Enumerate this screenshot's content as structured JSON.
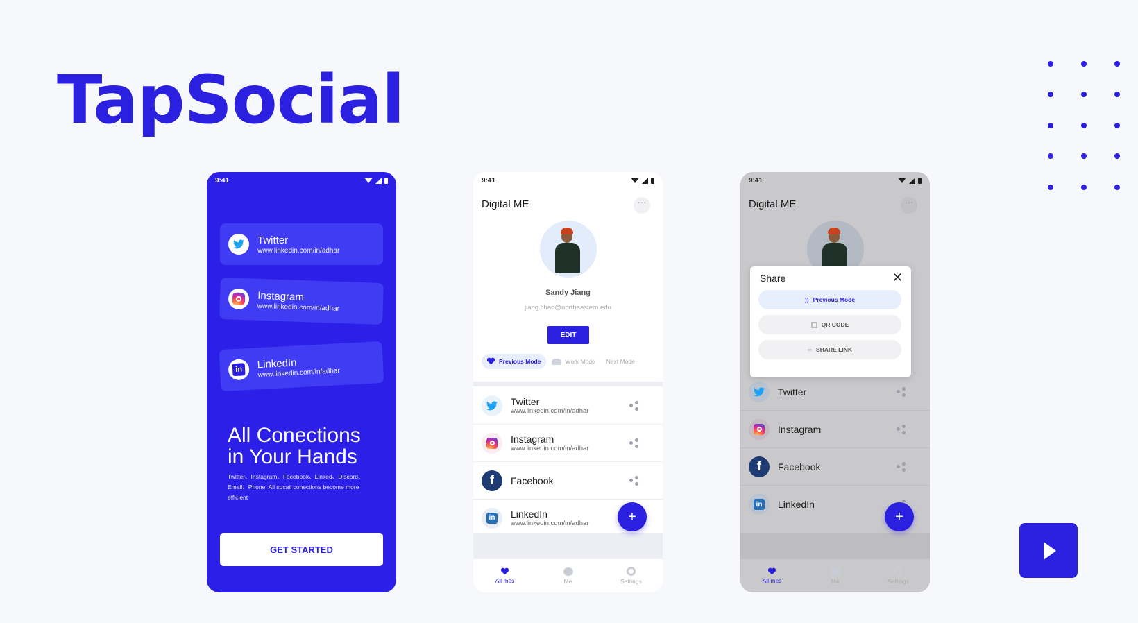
{
  "brand": {
    "title": "TapSocial",
    "color": "#2b1fe0"
  },
  "status_time": "9:41",
  "onboarding": {
    "cards": [
      {
        "name": "Twitter",
        "url": "www.linkedin.com/in/adhar",
        "icon": "twitter-icon"
      },
      {
        "name": "Instagram",
        "url": "www.linkedin.com/in/adhar",
        "icon": "instagram-icon"
      },
      {
        "name": "LinkedIn",
        "url": "www.linkedin.com/in/adhar",
        "icon": "linkedin-icon"
      }
    ],
    "headline_line1": "All Conections",
    "headline_line2": "in Your Hands",
    "subtext": "Twitter、Instagram、Facebook、Linked、Discord、Email、Phone. All socail conections become more efficient",
    "cta": "GET STARTED"
  },
  "profile": {
    "title": "Digital ME",
    "more": "···",
    "name": "Sandy Jiang",
    "email": "jiang.chao@northeastern.edu",
    "edit_label": "EDIT",
    "modes": [
      "Previous Mode",
      "Work Mode",
      "Next Mode"
    ],
    "socials": [
      {
        "name": "Twitter",
        "url": "www.linkedin.com/in/adhar"
      },
      {
        "name": "Instagram",
        "url": "www.linkedin.com/in/adhar"
      },
      {
        "name": "Facebook",
        "url": ""
      },
      {
        "name": "LinkedIn",
        "url": "www.linkedin.com/in/adhar"
      }
    ],
    "fab": "+",
    "nav": [
      "All mes",
      "Me",
      "Settings"
    ]
  },
  "share_dialog": {
    "title": "Share",
    "close": "✕",
    "options": [
      "Previous Mode",
      "QR CODE",
      "SHARE LINK"
    ],
    "socials": [
      "Twitter",
      "Instagram",
      "Facebook",
      "LinkedIn"
    ]
  }
}
